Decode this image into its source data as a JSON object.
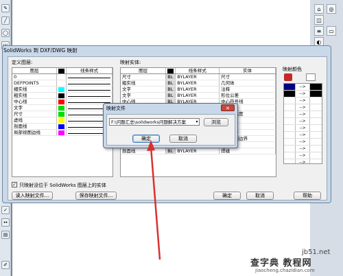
{
  "colors": {
    "accent_red": "#d93030",
    "title_bg": "#c9d9ea",
    "close_red": "#c8463a"
  },
  "left_toolbar": {
    "icons": [
      "sketch-icon",
      "line-icon",
      "circle-icon",
      "abc-text-icon",
      "check-icon",
      "dimension-icon",
      "note-icon"
    ],
    "abc_label": "ABC"
  },
  "right_toolbar": {
    "icons": [
      "home-icon",
      "cube-icon",
      "layers-icon",
      "folder-icon",
      "palette-icon",
      "globe-icon"
    ]
  },
  "dialog": {
    "title": "SolidWorks 到 DXF/DWG 映射",
    "define_label": "定义图层:",
    "map_label": "映射实体:",
    "color_label": "映射颜色",
    "left_grid": {
      "headers": [
        "图层",
        "",
        "线条样式"
      ],
      "rows": [
        {
          "name": "0",
          "color": "#ffffff",
          "style": "line"
        },
        {
          "name": "DEFPOINTS",
          "color": "#ffffff",
          "style": "line"
        },
        {
          "name": "细实线",
          "color": "#00ffff",
          "style": "line"
        },
        {
          "name": "粗实线",
          "color": "#000000",
          "style": "line"
        },
        {
          "name": "中心线",
          "color": "#ff0000",
          "style": "line"
        },
        {
          "name": "文字",
          "color": "#00dd00",
          "style": "line"
        },
        {
          "name": "尺寸",
          "color": "#00dd00",
          "style": "line"
        },
        {
          "name": "虚线",
          "color": "#ffff00",
          "style": "line"
        },
        {
          "name": "剖面线",
          "color": "#0000ff",
          "style": "line"
        },
        {
          "name": "局部视图边线",
          "color": "#ff00ff",
          "style": "line"
        }
      ]
    },
    "map_grid": {
      "headers": [
        "图层",
        "",
        "线条样式",
        "实体"
      ],
      "rows": [
        {
          "layer": "尺寸",
          "bl": "BL",
          "style": "BYLAYER",
          "entity": "尺寸"
        },
        {
          "layer": "粗实线",
          "bl": "BL",
          "style": "BYLAYER",
          "entity": "几何体"
        },
        {
          "layer": "文字",
          "bl": "BL",
          "style": "BYLAYER",
          "entity": "注释"
        },
        {
          "layer": "文字",
          "bl": "BL",
          "style": "BYLAYER",
          "entity": "形位公差"
        },
        {
          "layer": "中心线",
          "bl": "BL",
          "style": "BYLAYER",
          "entity": "中心符号线"
        },
        {
          "layer": "",
          "bl": "",
          "style": "",
          "entity": "中心线"
        },
        {
          "layer": "",
          "bl": "",
          "style": "",
          "entity": "表面粗糙度"
        },
        {
          "layer": "",
          "bl": "",
          "style": "",
          "entity": "基准"
        },
        {
          "layer": "",
          "bl": "",
          "style": "",
          "entity": "断裂线"
        },
        {
          "layer": "",
          "bl": "",
          "style": "",
          "entity": "零件序号"
        },
        {
          "layer": "",
          "bl": "",
          "style": "",
          "entity": "局部视图边界"
        },
        {
          "layer": "细实线",
          "bl": "BL",
          "style": "BYLAYER",
          "entity": "折断线"
        },
        {
          "layer": "剖面线",
          "bl": "BL",
          "style": "BYLAYER",
          "entity": "焊缝"
        }
      ]
    },
    "color_rows": [
      {
        "from": "#000080",
        "to": "#000000"
      },
      {
        "from": "#000000",
        "to": "#000000"
      },
      {
        "from": "#ffffff",
        "to": "#ffffff"
      },
      {
        "from": "#ffffff",
        "to": "#ffffff"
      },
      {
        "from": "#ffffff",
        "to": "#ffffff"
      },
      {
        "from": "#ffffff",
        "to": "#ffffff"
      },
      {
        "from": "#ffffff",
        "to": "#ffffff"
      },
      {
        "from": "#ffffff",
        "to": "#ffffff"
      },
      {
        "from": "#ffffff",
        "to": "#ffffff"
      },
      {
        "from": "#ffffff",
        "to": "#ffffff"
      },
      {
        "from": "#ffffff",
        "to": "#ffffff"
      },
      {
        "from": "#ffffff",
        "to": "#ffffff"
      }
    ],
    "arrow": "-->",
    "checkbox_label": "只映射没位于 SolidWorks 图层上的实体",
    "checkbox_checked": true,
    "read_btn": "读入映射文件...",
    "save_btn": "保存映射文件...",
    "ok_btn": "确定",
    "cancel_btn": "取消",
    "help_btn": "帮助"
  },
  "popup": {
    "title": "映射文件",
    "path_value": "F:\\问题汇总\\solidworks问题解决方案",
    "browse_btn": "浏览",
    "ok_btn": "确定",
    "cancel_btn": "取消"
  },
  "watermark": {
    "top": "jb51.net",
    "brand": "查字典 教程网",
    "url": "jiaocheng.chazidian.com"
  }
}
